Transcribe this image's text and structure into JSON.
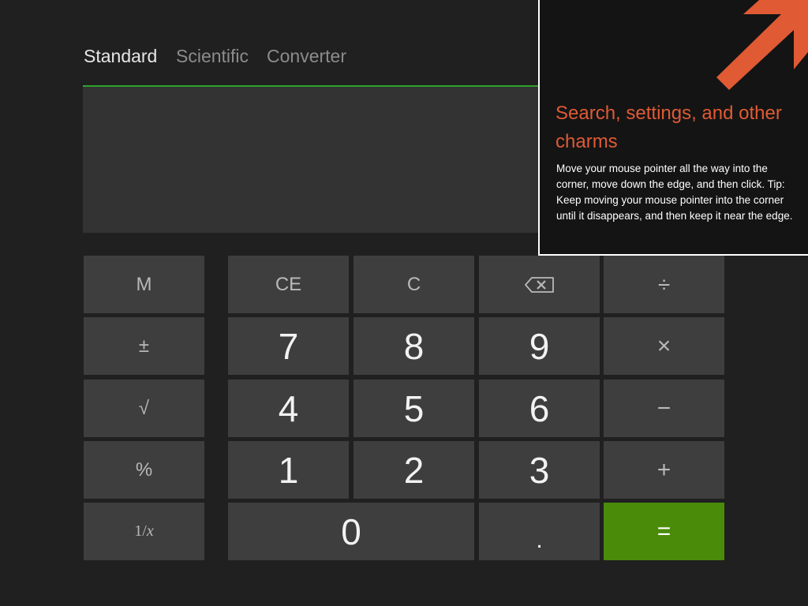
{
  "tabs": [
    {
      "label": "Standard",
      "active": true
    },
    {
      "label": "Scientific",
      "active": false
    },
    {
      "label": "Converter",
      "active": false
    }
  ],
  "display": {
    "value": ""
  },
  "keys": {
    "memory": "M",
    "negate": "±",
    "sqrt": "√",
    "percent": "%",
    "reciprocal_num": "1/",
    "reciprocal_var": "x",
    "ce": "CE",
    "c": "C",
    "backspace_icon": "backspace-icon",
    "divide": "÷",
    "multiply": "×",
    "subtract": "−",
    "add": "+",
    "equals": "=",
    "decimal": ".",
    "seven": "7",
    "eight": "8",
    "nine": "9",
    "four": "4",
    "five": "5",
    "six": "6",
    "one": "1",
    "two": "2",
    "three": "3",
    "zero": "0"
  },
  "tip": {
    "title": "Search, settings, and other charms",
    "body": "Move your mouse pointer all the way into the corner, move down the edge, and then click. Tip: Keep moving your mouse pointer into the corner until it disappears, and then keep it near the edge.",
    "arrow_icon": "corner-arrow-icon"
  },
  "colors": {
    "background": "#202020",
    "key": "#3e3e3e",
    "equals": "#4a8c0a",
    "accent_line": "#2ea12e",
    "tip_title": "#e05a34"
  }
}
